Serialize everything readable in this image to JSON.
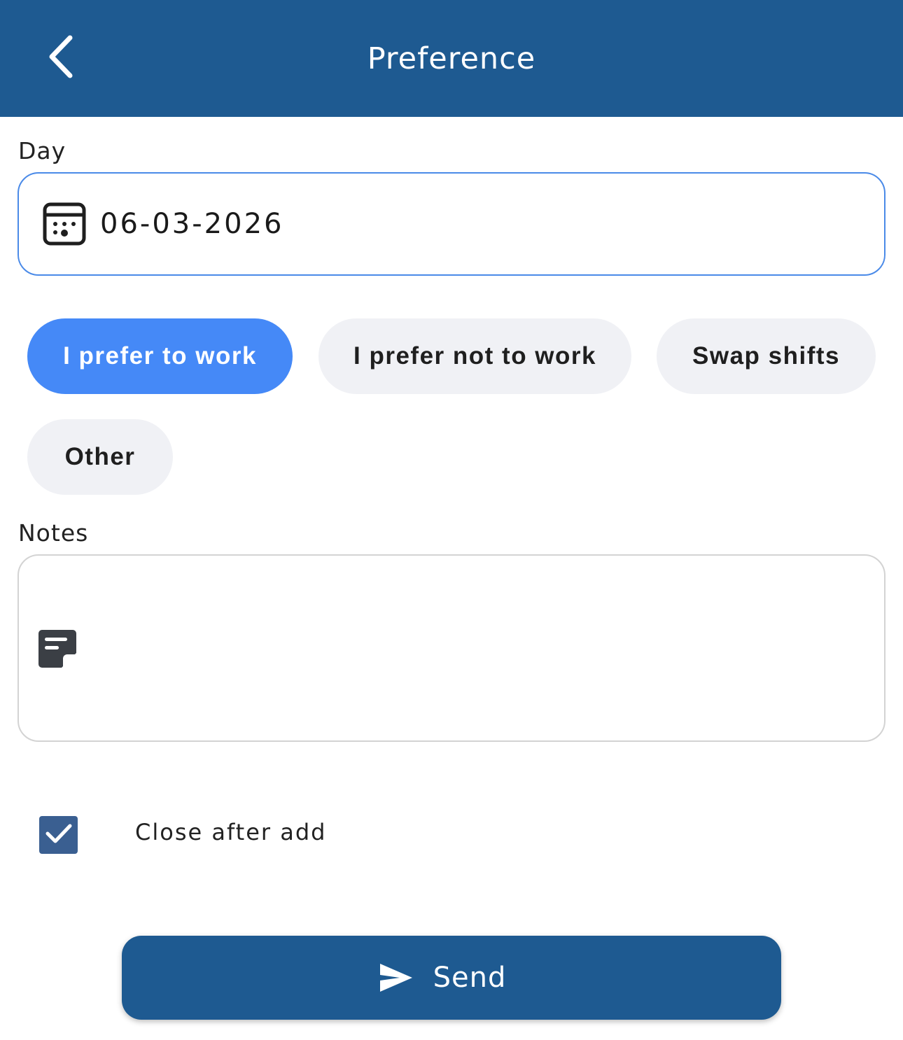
{
  "header": {
    "title": "Preference",
    "back_icon": "chevron-left-icon",
    "background_color": "#1e5a91"
  },
  "day": {
    "label": "Day",
    "value": "06-03-2026",
    "icon": "calendar-icon"
  },
  "preference_options": {
    "selected_index": 0,
    "items": [
      {
        "label": "I prefer to work"
      },
      {
        "label": "I prefer not to work"
      },
      {
        "label": "Swap shifts"
      },
      {
        "label": "Other"
      }
    ],
    "selected_color": "#4589f7"
  },
  "notes": {
    "label": "Notes",
    "value": "",
    "icon": "note-icon"
  },
  "close_after_add": {
    "checked": true,
    "label": "Close after add"
  },
  "send": {
    "label": "Send",
    "icon": "send-icon"
  }
}
